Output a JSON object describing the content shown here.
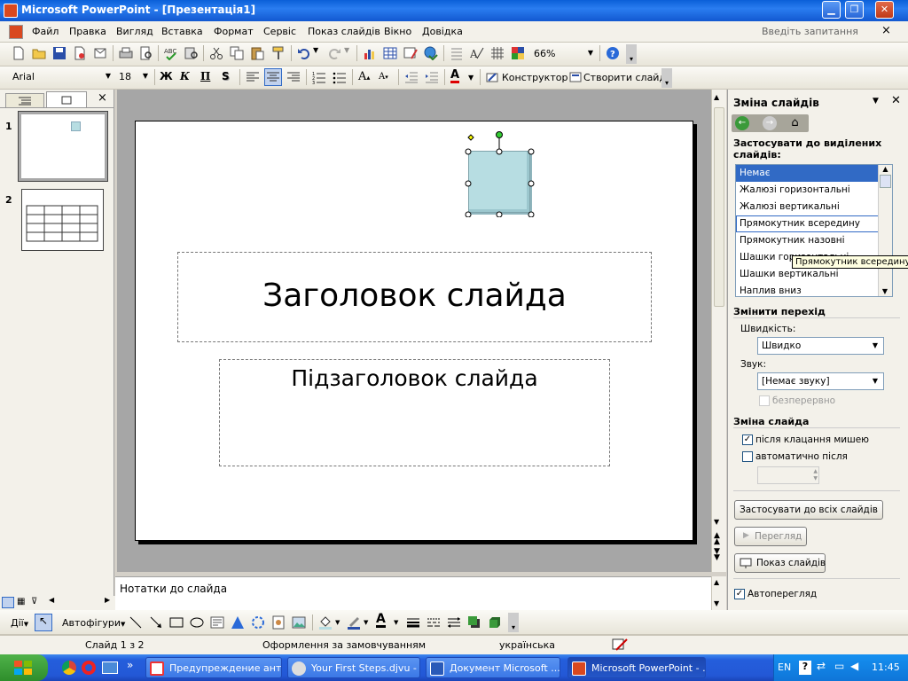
{
  "window": {
    "title": "Microsoft PowerPoint - [Презентація1]"
  },
  "menu": {
    "items": [
      "Файл",
      "Правка",
      "Вигляд",
      "Вставка",
      "Формат",
      "Сервіс",
      "Показ слайдів",
      "Вікно",
      "Довідка"
    ],
    "help_placeholder": "Введіть запитання",
    "close": "×"
  },
  "toolbar": {
    "zoom": "66%",
    "font": "Arial",
    "font_size": "18",
    "bold": "Ж",
    "italic": "К",
    "underline": "П",
    "shadow": "S",
    "font_grow": "A",
    "font_shrink": "A",
    "font_color": "A",
    "designer": "Конструктор",
    "new_slide": "Створити слайд"
  },
  "slides_panel": {
    "numbers": [
      "1",
      "2"
    ],
    "close": "×"
  },
  "slide": {
    "title": "Заголовок слайда",
    "subtitle": "Підзаголовок слайда"
  },
  "notes": {
    "placeholder": "Нотатки до слайда"
  },
  "taskpane": {
    "title": "Зміна слайдів",
    "apply_selected": "Застосувати до виділених слайдів:",
    "transitions": [
      "Немає",
      "Жалюзі горизонтальні",
      "Жалюзі вертикальні",
      "Прямокутник всередину",
      "Прямокутник назовні",
      "Шашки горизонтальні",
      "Шашки вертикальні",
      "Наплив вниз"
    ],
    "selected_index": 0,
    "hover_index": 3,
    "tooltip": "Прямокутник всередину",
    "modify_header": "Змінити перехід",
    "speed_label": "Швидкість:",
    "speed_value": "Швидко",
    "sound_label": "Звук:",
    "sound_value": "[Немає звуку]",
    "loop_label": "безперервно",
    "advance_header": "Зміна слайда",
    "on_click_label": "після клацання мишею",
    "on_click_checked": true,
    "auto_label": "автоматично після",
    "auto_checked": false,
    "apply_all": "Застосувати до всіх слайдів",
    "preview": "Перегляд",
    "slideshow": "Показ слайдів",
    "autopreview_label": "Автоперегляд",
    "autopreview_checked": true
  },
  "drawbar": {
    "actions": "Дії",
    "autoshapes": "Автофігури"
  },
  "status": {
    "slide": "Слайд 1 з 2",
    "design": "Оформлення за замовчуванням",
    "language": "українська"
  },
  "taskbar": {
    "tasks": [
      "Предупреждение ант...",
      "Your First Steps.djvu - ...",
      "Документ Microsoft ...",
      "Microsoft PowerPoint - ..."
    ],
    "lang": "EN",
    "time": "11:45"
  },
  "colors": {
    "accent": "#316ac5",
    "titlebar": "#0a5fd8",
    "slide_shape": "#b7dde2"
  }
}
